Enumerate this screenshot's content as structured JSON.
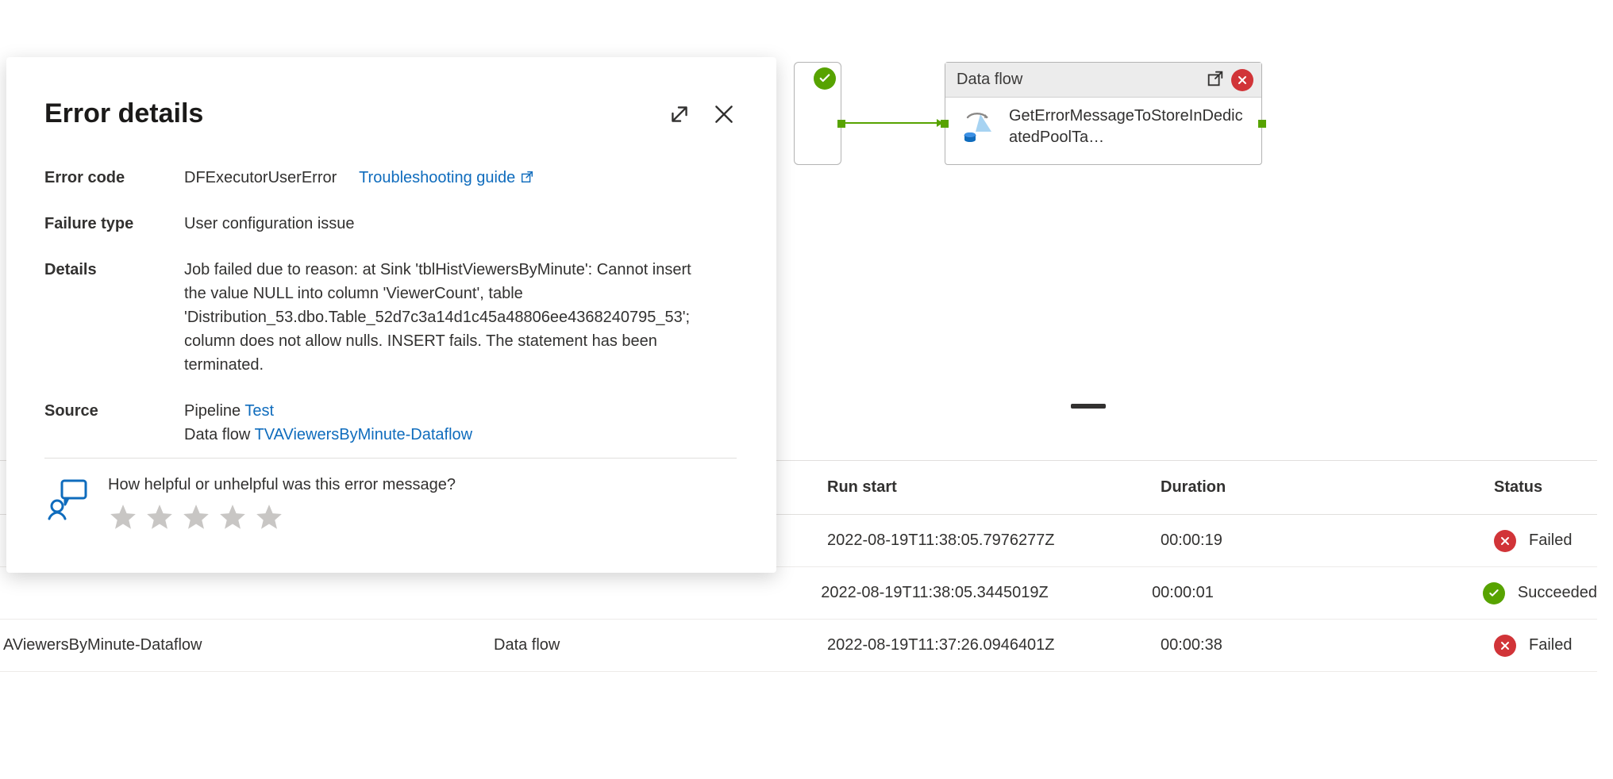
{
  "panel": {
    "title": "Error details",
    "error_code_label": "Error code",
    "error_code_value": "DFExecutorUserError",
    "troubleshooting_label": "Troubleshooting guide",
    "failure_type_label": "Failure type",
    "failure_type_value": "User configuration issue",
    "details_label": "Details",
    "details_value": "Job failed due to reason: at Sink 'tblHistViewersByMinute': Cannot insert the value NULL into column 'ViewerCount', table 'Distribution_53.dbo.Table_52d7c3a14d1c45a48806ee4368240795_53'; column does not allow nulls. INSERT fails. The statement has been terminated.",
    "source_label": "Source",
    "source_pipeline_prefix": "Pipeline ",
    "source_pipeline_link": "Test",
    "source_dataflow_prefix": "Data flow ",
    "source_dataflow_link": "TVAViewersByMinute-Dataflow",
    "feedback_question": "How helpful or unhelpful was this error message?"
  },
  "node": {
    "header_label": "Data flow",
    "activity_label": "GetErrorMessageToStoreInDedicatedPoolTa…"
  },
  "runs": {
    "headers": {
      "start": "Run start",
      "duration": "Duration",
      "status": "Status"
    },
    "row_name": "AViewersByMinute-Dataflow",
    "row_type": "Data flow",
    "rows": [
      {
        "start": "2022-08-19T11:38:05.7976277Z",
        "duration": "00:00:19",
        "status": "Failed",
        "status_kind": "fail"
      },
      {
        "start": "2022-08-19T11:38:05.3445019Z",
        "duration": "00:00:01",
        "status": "Succeeded",
        "status_kind": "pass"
      },
      {
        "start": "2022-08-19T11:37:26.0946401Z",
        "duration": "00:00:38",
        "status": "Failed",
        "status_kind": "fail"
      }
    ]
  }
}
